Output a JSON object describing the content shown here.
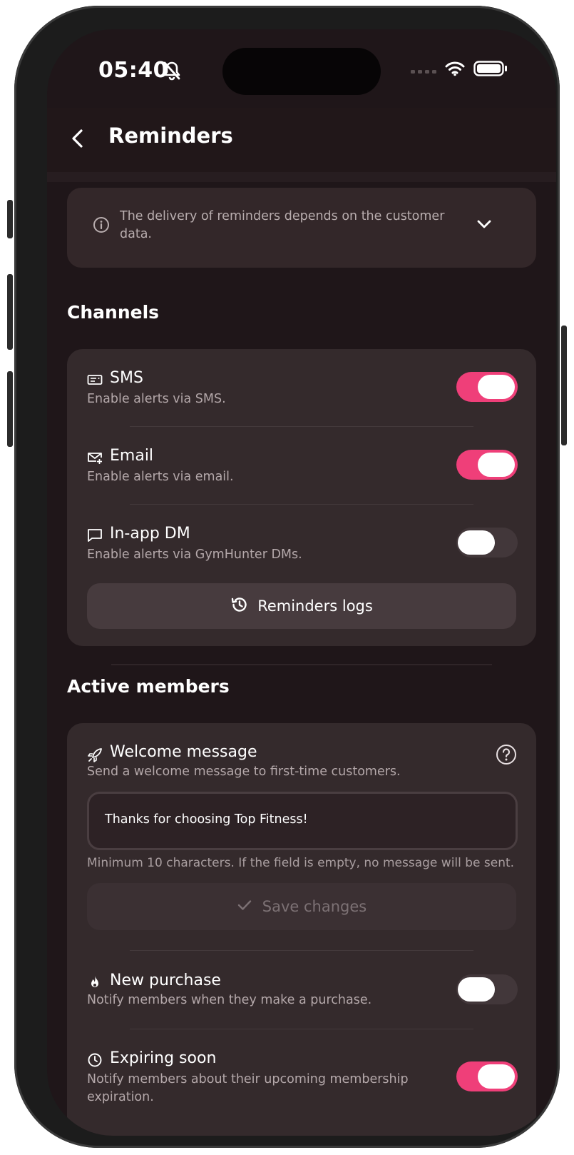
{
  "status_bar": {
    "time": "05:40"
  },
  "header": {
    "title": "Reminders"
  },
  "info_banner": {
    "text": "The delivery of reminders depends on the customer data."
  },
  "channels": {
    "section_title": "Channels",
    "items": [
      {
        "icon": "sms-icon",
        "title": "SMS",
        "subtitle": "Enable alerts via SMS.",
        "enabled": true
      },
      {
        "icon": "email-icon",
        "title": "Email",
        "subtitle": "Enable alerts via email.",
        "enabled": true
      },
      {
        "icon": "chat-icon",
        "title": "In-app DM",
        "subtitle": "Enable alerts via GymHunter DMs.",
        "enabled": false
      }
    ],
    "logs_button": "Reminders logs"
  },
  "active_members": {
    "section_title": "Active members",
    "welcome": {
      "title": "Welcome message",
      "subtitle": "Send a welcome message to first-time customers.",
      "message_value": "Thanks for choosing Top Fitness!",
      "hint": "Minimum 10 characters. If the field is empty, no message will be sent.",
      "save_button": "Save changes"
    },
    "new_purchase": {
      "title": "New purchase",
      "subtitle": "Notify members when they make a purchase.",
      "enabled": false
    },
    "expiring_soon": {
      "title": "Expiring soon",
      "subtitle": "Notify members about their upcoming membership expiration.",
      "enabled": true
    }
  },
  "colors": {
    "accent": "#ef3f79",
    "background": "#1f1619",
    "card": "#342a2c"
  }
}
